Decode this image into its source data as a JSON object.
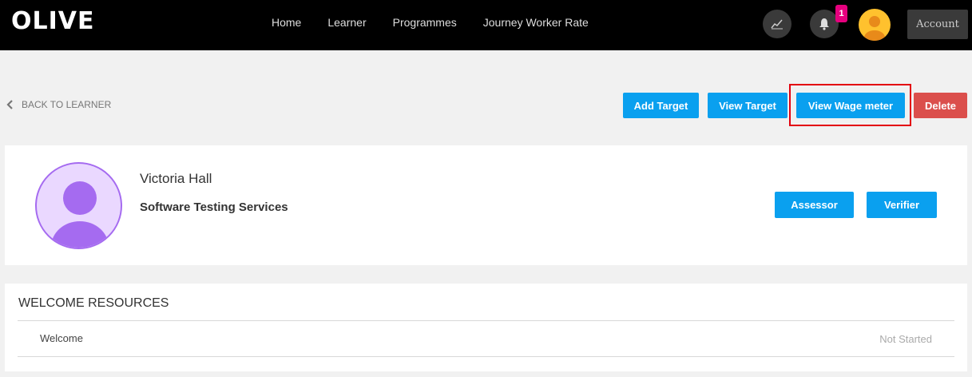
{
  "header": {
    "logo": "OLIVE",
    "nav": [
      "Home",
      "Learner",
      "Programmes",
      "Journey Worker Rate"
    ],
    "notification_count": "1",
    "account_label": "Account"
  },
  "toolbar": {
    "back_label": "BACK TO LEARNER",
    "add_target": "Add Target",
    "view_target": "View Target",
    "view_wage_meter": "View Wage meter",
    "delete": "Delete"
  },
  "profile": {
    "name": "Victoria Hall",
    "company": "Software Testing Services",
    "assessor_label": "Assessor",
    "verifier_label": "Verifier"
  },
  "resources": {
    "title": "WELCOME RESOURCES",
    "items": [
      {
        "name": "Welcome",
        "status": "Not Started"
      }
    ]
  },
  "colors": {
    "primary": "#0aa0ef",
    "danger": "#db4f4c",
    "highlight": "#e3000f",
    "badge": "#e6007e"
  }
}
